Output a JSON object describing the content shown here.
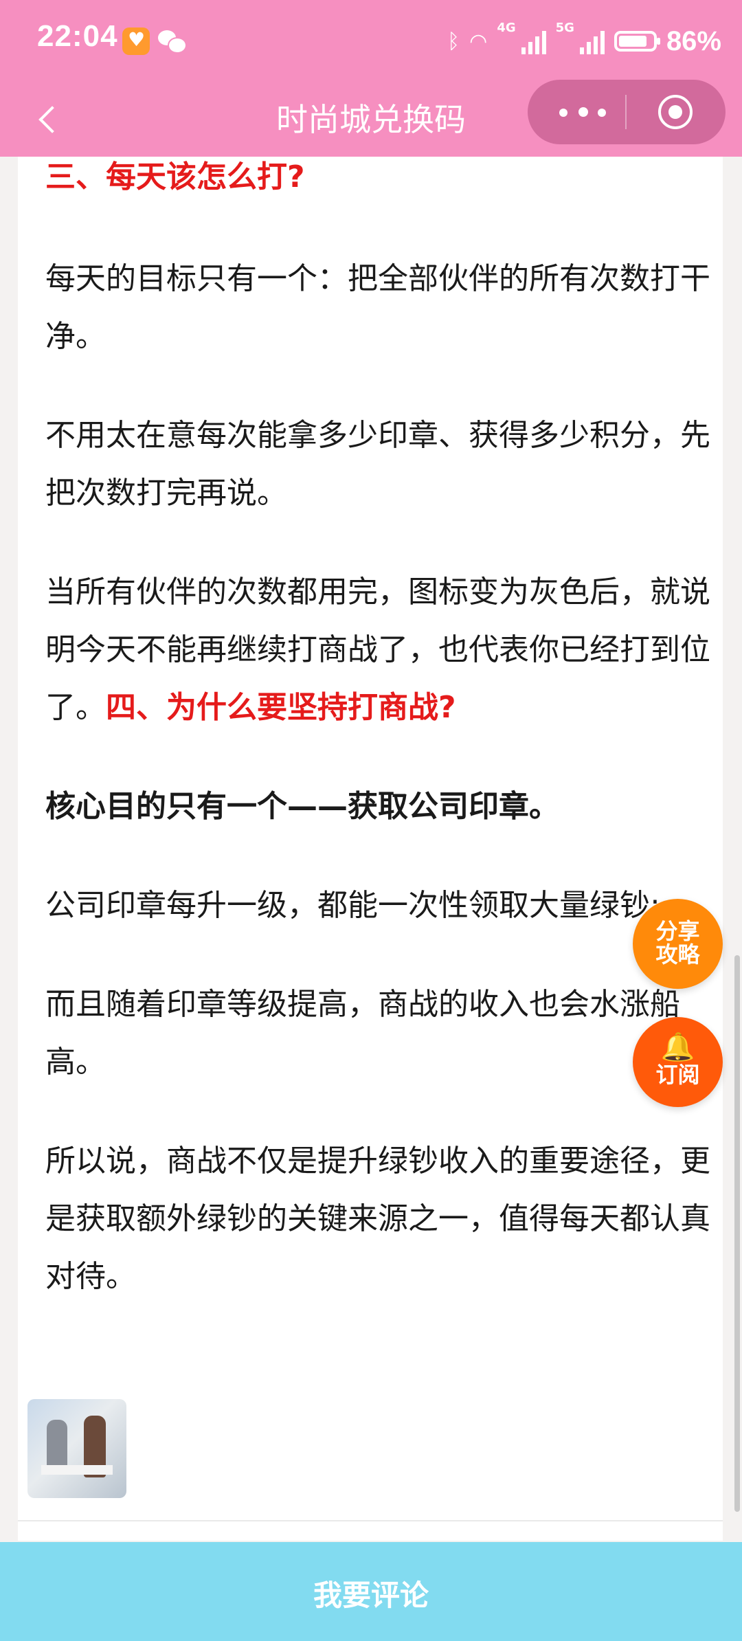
{
  "status_bar": {
    "time": "22:04",
    "network_1": "4G",
    "network_2": "5G",
    "battery": "86%",
    "battery_level": 0.86
  },
  "nav": {
    "title": "时尚城兑换码"
  },
  "article": {
    "p1": "三、每天该怎么打?",
    "p2": "每天的目标只有一个：把全部伙伴的所有次数打干净。",
    "p3": "不用太在意每次能拿多少印章、获得多少积分，先把次数打完再说。",
    "p4_text": "当所有伙伴的次数都用完，图标变为灰色后，就说明今天不能再继续打商战了，也代表你已经打到位了。",
    "p4_heading": "四、为什么要坚持打商战?",
    "p5": "核心目的只有一个——获取公司印章。",
    "p6": "公司印章每升一级，都能一次性领取大量绿钞;",
    "p7": "而且随着印章等级提高，商战的收入也会水涨船高。",
    "p8": "所以说，商战不仅是提升绿钞收入的重要途径，更是获取额外绿钞的关键来源之一，值得每天都认真对待。"
  },
  "floating": {
    "share": "分享攻略",
    "subscribe": "订阅"
  },
  "bottom": {
    "comment": "我要评论"
  },
  "colors": {
    "header": "#f68fc0",
    "heading_red": "#e51b1b",
    "share": "#ff8a0a",
    "subscribe": "#ff5a0a",
    "bottom_bar": "#82dbf0"
  }
}
